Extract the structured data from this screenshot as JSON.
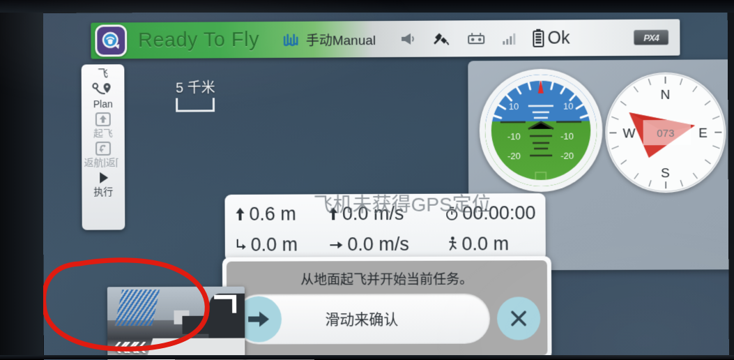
{
  "toolbar": {
    "logo_name": "qgroundcontrol-logo",
    "flight_state": "Ready To Fly",
    "mode_icon": "waypoint-wave-icon",
    "mode_label": "手动Manual",
    "icons": [
      "megaphone-icon",
      "gps-disconnected-icon",
      "rc-controller-icon",
      "signal-bars-icon"
    ],
    "battery_status": "Ok",
    "px4_badge": "PX4"
  },
  "flybar": {
    "top_glyph": "飞",
    "items": [
      {
        "icon": "route-plan-icon",
        "label": "Plan",
        "enabled": true
      },
      {
        "icon": "takeoff-up-arrow-icon",
        "label": "起飞",
        "enabled": false
      },
      {
        "icon": "return-home-icon",
        "label": "返航|返[",
        "enabled": false
      },
      {
        "icon": "play-triangle-icon",
        "label": "执行",
        "enabled": true
      }
    ]
  },
  "map": {
    "scale_label": "5 千米",
    "background_color": "#3a4f63"
  },
  "instruments": {
    "attitude": {
      "name": "attitude-indicator",
      "pitch_labels": [
        "10",
        "10",
        "-10",
        "-10",
        "-20",
        "-20"
      ],
      "sky_color": "#3b7fc4",
      "ground_color": "#56a93a",
      "roll_pointer_color": "#e02b2b"
    },
    "compass": {
      "name": "compass-heading-indicator",
      "cardinals": [
        "N",
        "E",
        "S",
        "W"
      ],
      "heading": "073",
      "needle_color": "#d02a22"
    },
    "record_button": {
      "name": "record-button",
      "color": "#f4534e"
    }
  },
  "telemetry": {
    "rows": [
      [
        {
          "icon": "altitude-up-icon",
          "glyph": "⬆",
          "value": "0.6 m"
        },
        {
          "icon": "vertical-speed-icon",
          "glyph": "⬆",
          "value": "0.0 m/s"
        },
        {
          "icon": "flight-time-icon",
          "glyph": "⏱",
          "value": "00:00:00"
        }
      ],
      [
        {
          "icon": "ground-distance-icon",
          "glyph": "↳",
          "value": "0.0 m"
        },
        {
          "icon": "ground-speed-icon",
          "glyph": "→",
          "value": "0.0 m/s"
        },
        {
          "icon": "distance-to-home-icon",
          "glyph": "🚶",
          "value": "0.0 m"
        }
      ]
    ]
  },
  "toast": {
    "message": "飞机未获得GPS定位"
  },
  "dialog": {
    "message": "从地面起飞并开始当前任务。",
    "slider_label": "滑动来确认",
    "slider_knob_icon": "arrow-right-icon",
    "cancel_icon": "close-x-icon",
    "accent_color": "#a8d5e0"
  },
  "video": {
    "name": "video-thumbnail",
    "collapse_icon": "chevrons-left-icon",
    "collapse_glyph": "«««",
    "expand_icon": "expand-corner-icon",
    "annotation_color": "#e01b10"
  }
}
